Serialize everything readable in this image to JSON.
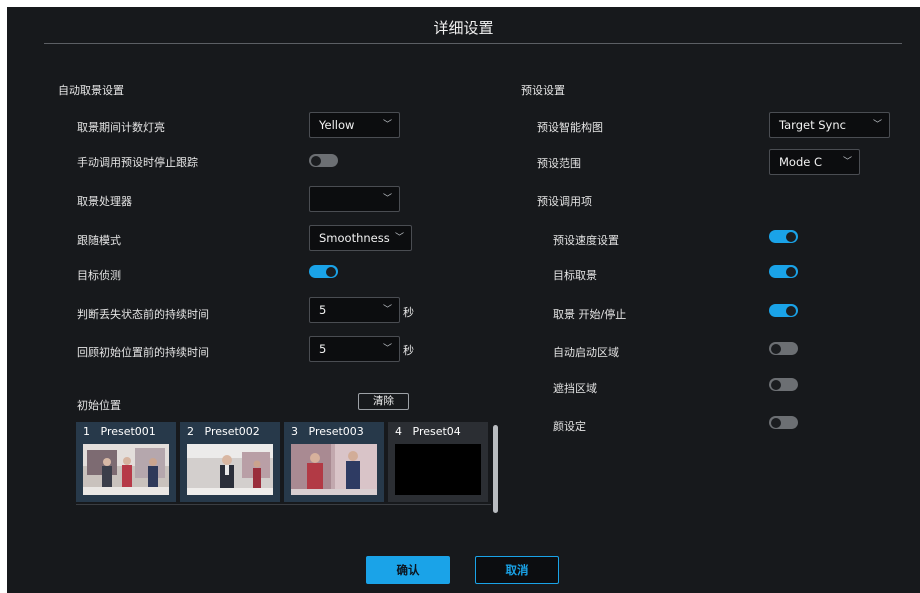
{
  "dialog": {
    "title": "详细设置"
  },
  "auto_framing": {
    "section_title": "自动取景设置",
    "rows": [
      {
        "label": "取景期间计数灯亮",
        "control": "select",
        "value": "Yellow"
      },
      {
        "label": "手动调用预设时停止跟踪",
        "control": "toggle",
        "state": "off"
      },
      {
        "label": "取景处理器",
        "control": "select",
        "value": ""
      },
      {
        "label": "跟随模式",
        "control": "select",
        "value": "Smoothness"
      },
      {
        "label": "目标侦测",
        "control": "toggle",
        "state": "on"
      },
      {
        "label": "判断丢失状态前的持续时间",
        "control": "select",
        "value": "5",
        "unit": "秒"
      },
      {
        "label": "回顾初始位置前的持续时间",
        "control": "select",
        "value": "5",
        "unit": "秒"
      }
    ]
  },
  "initial_position": {
    "label": "初始位置",
    "clear_button": "清除",
    "presets": [
      {
        "number": "1",
        "name": "Preset001",
        "thumbnail": "studio-scene-1"
      },
      {
        "number": "2",
        "name": "Preset002",
        "thumbnail": "studio-scene-2"
      },
      {
        "number": "3",
        "name": "Preset003",
        "thumbnail": "studio-scene-3"
      },
      {
        "number": "4",
        "name": "Preset04",
        "thumbnail": "empty-black"
      }
    ]
  },
  "preset_settings": {
    "section_title": "预设设置",
    "rows": [
      {
        "label": "预设智能构图",
        "control": "select",
        "value": "Target Sync"
      },
      {
        "label": "预设范围",
        "control": "select",
        "value": "Mode C"
      },
      {
        "label": "预设调用项",
        "control": "none"
      }
    ],
    "recall_items": [
      {
        "label": "预设速度设置",
        "state": "on"
      },
      {
        "label": "目标取景",
        "state": "on"
      },
      {
        "label": "取景 开始/停止",
        "state": "on"
      },
      {
        "label": "自动启动区域",
        "state": "off"
      },
      {
        "label": "遮挡区域",
        "state": "off"
      },
      {
        "label": "颜设定",
        "state": "off"
      }
    ]
  },
  "footer": {
    "confirm": "确认",
    "cancel": "取消"
  },
  "colors": {
    "accent": "#1aa3e8",
    "background": "#17191c",
    "preset_tile": "#27394a"
  }
}
